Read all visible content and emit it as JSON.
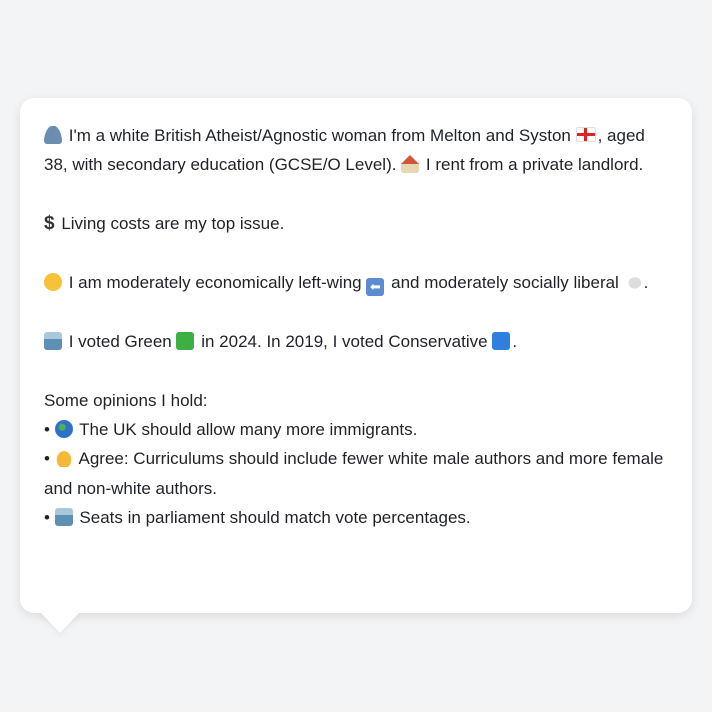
{
  "bio": {
    "line1_a": "I'm a white British Atheist/Agnostic woman from Melton and Syston",
    "line1_b": ", aged 38, with secondary education (GCSE/O Level).",
    "line1_c": "I rent from a private landlord.",
    "issue": "Living costs are my top issue.",
    "ideology_a": "I am moderately economically left-wing",
    "ideology_b": "and moderately socially liberal",
    "ideology_c": ".",
    "vote_a": "I voted Green",
    "vote_b": "in 2024. In 2019, I voted Conservative",
    "vote_c": ".",
    "opinions_heading": "Some opinions I hold:",
    "opinions": [
      {
        "bullet": "•",
        "icon": "globe-icon",
        "text": "The UK should allow many more immigrants."
      },
      {
        "bullet": "•",
        "icon": "thumbs-up-icon",
        "text": "Agree: Curriculums should include fewer white male authors and more female and non-white authors."
      },
      {
        "bullet": "•",
        "icon": "ballot-box-icon",
        "text": "Seats in parliament should match vote percentages."
      }
    ]
  },
  "colors": {
    "green": "#3cb043",
    "blue": "#2f7fe0",
    "card": "#ffffff",
    "background": "#f3f4f6"
  }
}
